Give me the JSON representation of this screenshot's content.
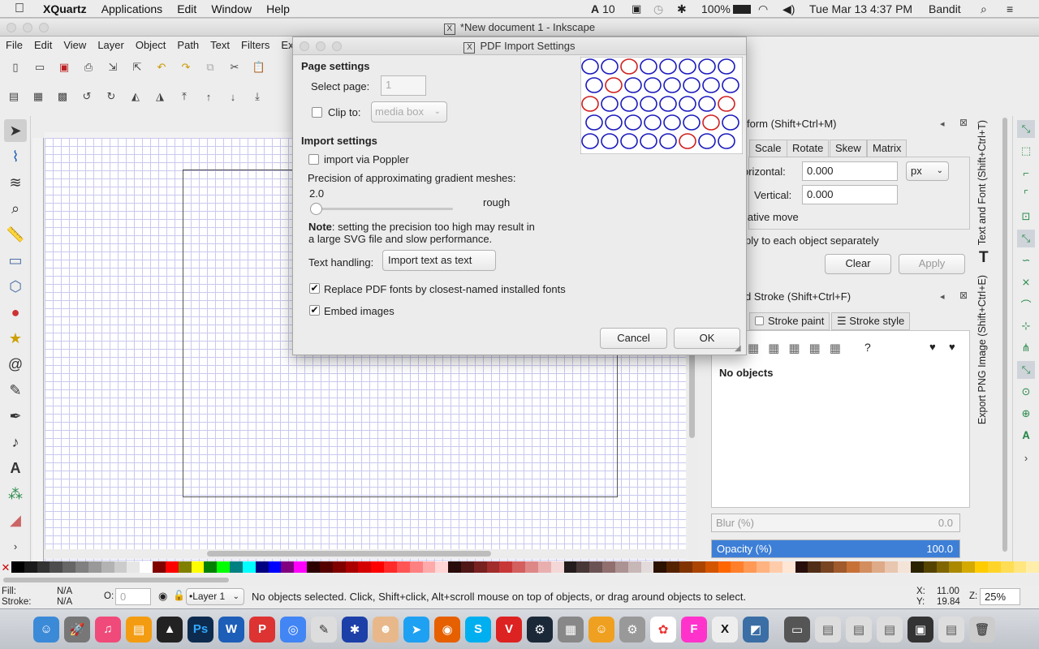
{
  "menubar": {
    "app_name": "XQuartz",
    "items": [
      "Applications",
      "Edit",
      "Window",
      "Help"
    ],
    "status": {
      "adobe": "10",
      "battery": "100%",
      "clock": "Tue Mar 13  4:37 PM",
      "user": "Bandit"
    }
  },
  "window": {
    "title": "*New document 1 - Inkscape",
    "menu": [
      "File",
      "Edit",
      "View",
      "Layer",
      "Object",
      "Path",
      "Text",
      "Filters",
      "Exte"
    ]
  },
  "transform_panel": {
    "title": "form (Shift+Ctrl+M)",
    "tabs": [
      "Scale",
      "Rotate",
      "Skew",
      "Matrix"
    ],
    "horizontal_label": "orizontal:",
    "horizontal_value": "0.000",
    "unit": "px",
    "vertical_label": "Vertical:",
    "vertical_value": "0.000",
    "relative_label": "lative move",
    "each_label": "ply to each object separately",
    "clear_label": "Clear",
    "apply_label": "Apply"
  },
  "fill_panel": {
    "title": "d Stroke (Shift+Ctrl+F)",
    "tab_stroke_paint": "Stroke paint",
    "tab_stroke_style": "Stroke style",
    "no_objects": "No objects",
    "blur_label": "Blur (%)",
    "blur_value": "0.0",
    "opacity_label": "Opacity (%)",
    "opacity_value": "100.0",
    "opacity_level": 1.0
  },
  "vertical_tabs": [
    "Text and Font (Shift+Ctrl+T)",
    "Export PNG Image (Shift+Ctrl+E)"
  ],
  "statusbar": {
    "fill_label": "Fill:",
    "fill_value": "N/A",
    "stroke_label": "Stroke:",
    "stroke_value": "N/A",
    "opacity_label": "O:",
    "opacity_value": "0",
    "layer": "•Layer 1",
    "message": "No objects selected. Click, Shift+click, Alt+scroll mouse on top of objects, or drag around objects to select.",
    "x_label": "X:",
    "x_value": "11.00",
    "y_label": "Y:",
    "y_value": "19.84",
    "zoom_label": "Z:",
    "zoom_value": "25%"
  },
  "dialog": {
    "title": "PDF Import Settings",
    "page_settings": "Page settings",
    "select_page_label": "Select page:",
    "select_page_value": "1",
    "clip_label": "Clip to:",
    "clip_value": "media box",
    "import_settings": "Import settings",
    "poppler_label": "import via Poppler",
    "precision_label": "Precision of approximating gradient meshes:",
    "precision_value": "2.0",
    "rough_label": "rough",
    "note_bold": "Note",
    "note_text": ": setting the precision too high may result in",
    "note_text2": "a large SVG file and slow performance.",
    "text_handling_label": "Text handling:",
    "text_handling_value": "Import text as text",
    "replace_fonts_label": "Replace PDF fonts by closest-named installed fonts",
    "embed_images_label": "Embed images",
    "cancel_label": "Cancel",
    "ok_label": "OK"
  },
  "colors": {
    "accent": "#3d7fd6",
    "grid": "#c9c9ef"
  },
  "palette": [
    "#000000",
    "#1a1a1a",
    "#333333",
    "#4d4d4d",
    "#666666",
    "#808080",
    "#999999",
    "#b3b3b3",
    "#cccccc",
    "#e6e6e6",
    "#ffffff",
    "#800000",
    "#ff0000",
    "#808000",
    "#ffff00",
    "#008000",
    "#00ff00",
    "#008080",
    "#00ffff",
    "#000080",
    "#0000ff",
    "#800080",
    "#ff00ff",
    "#2b0000",
    "#550000",
    "#800000",
    "#aa0000",
    "#d40000",
    "#ff0000",
    "#ff2a2a",
    "#ff5555",
    "#ff8080",
    "#ffaaaa",
    "#ffd5d5",
    "#280b0b",
    "#501616",
    "#782121",
    "#a02c2c",
    "#c83737",
    "#d35f5f",
    "#de8787",
    "#e9afaf",
    "#f4d7d7",
    "#241c1c",
    "#483737",
    "#6c5353",
    "#916f6f",
    "#ac9393",
    "#c8b7b7",
    "#e3dbdb",
    "#2b1100",
    "#552200",
    "#803300",
    "#aa4400",
    "#d45500",
    "#ff6600",
    "#ff7f2a",
    "#ff9955",
    "#ffb380",
    "#ffccaa",
    "#ffe6d5",
    "#280f0b",
    "#502d16",
    "#784421",
    "#a05a2c",
    "#c87137",
    "#d38d5f",
    "#deaa87",
    "#e9c6af",
    "#f4e3d7",
    "#2b2200",
    "#554400",
    "#806600",
    "#aa8800",
    "#d4aa00",
    "#ffcc00",
    "#ffd42a",
    "#ffdd55",
    "#ffe680",
    "#ffeeaa"
  ]
}
